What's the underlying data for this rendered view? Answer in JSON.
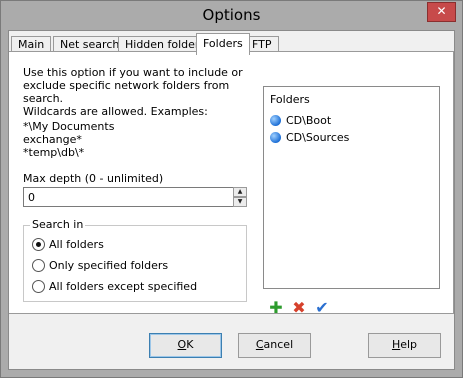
{
  "window": {
    "title": "Options",
    "close_glyph": "✕"
  },
  "tabs": [
    {
      "label": "Main",
      "active": false
    },
    {
      "label": "Net search",
      "active": false
    },
    {
      "label": "Hidden folders",
      "active": false
    },
    {
      "label": "Folders",
      "active": true
    },
    {
      "label": "FTP",
      "active": false
    }
  ],
  "folders_tab": {
    "description_lines": [
      "Use this option if you want to include or",
      "exclude specific network folders from search.",
      "Wildcards are allowed. Examples:"
    ],
    "examples": [
      "*\\My Documents",
      "exchange*",
      "*temp\\db\\*"
    ],
    "max_depth_label": "Max depth (0 - unlimited)",
    "max_depth_value": "0",
    "search_in": {
      "legend": "Search in",
      "options": [
        {
          "label": "All folders",
          "checked": true
        },
        {
          "label": "Only specified folders",
          "checked": false
        },
        {
          "label": "All folders except specified",
          "checked": false
        }
      ]
    },
    "folders_list": {
      "header": "Folders",
      "items": [
        "CD\\Boot",
        "CD\\Sources"
      ]
    },
    "action_icons": {
      "add": "add-icon",
      "remove": "remove-icon",
      "apply": "checkmark-icon"
    }
  },
  "buttons": {
    "ok": {
      "mnemonic": "O",
      "rest": "K"
    },
    "cancel": {
      "mnemonic": "C",
      "rest": "ancel"
    },
    "help": {
      "mnemonic": "H",
      "rest": "elp"
    }
  }
}
